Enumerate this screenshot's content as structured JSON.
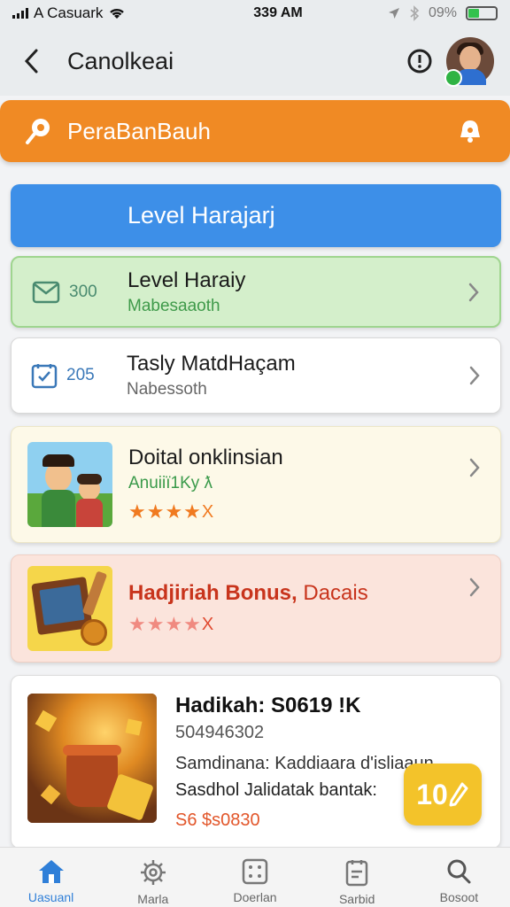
{
  "status_bar": {
    "carrier": "A Casuark",
    "time": "339 AM",
    "battery": "09%"
  },
  "app_bar": {
    "title": "Canolkeai"
  },
  "banner": {
    "text": "PeraBanBauh",
    "color": "#f08a24"
  },
  "level_button": {
    "label": "Level Harajarj",
    "color": "#3d8fe8"
  },
  "rows": [
    {
      "number": "300",
      "title": "Level Haraiy",
      "subtitle": "Mabesaaoth"
    },
    {
      "number": "205",
      "title": "Tasly MatdHaçam",
      "subtitle": "Nabessoth"
    }
  ],
  "promo_cards": [
    {
      "title": "Doital onklinsian",
      "subtitle": "Anuiiï1Ky  ƛ",
      "stars_suffix": "X",
      "rating_stars": 4
    },
    {
      "title": "Hadjiriah Bonus,",
      "title_extra": "Dacais",
      "stars_suffix": "X",
      "rating_stars": 4
    }
  ],
  "offer": {
    "title": "Hadikah: S0619 !K",
    "id": "504946302",
    "line1": "Samdinana: Kaddiaara d'isliaaun",
    "line2": "Sasdhol Jalidatak bantak:",
    "price": "S6 $s0830",
    "fab_label": "10"
  },
  "tabs": [
    {
      "label": "Uasuanl",
      "icon": "home-icon",
      "active": true
    },
    {
      "label": "Marla",
      "icon": "gear-icon",
      "active": false
    },
    {
      "label": "Doerlan",
      "icon": "dice-icon",
      "active": false
    },
    {
      "label": "Sarbid",
      "icon": "document-icon",
      "active": false
    },
    {
      "label": "Bosoot",
      "icon": "search-icon",
      "active": false
    }
  ]
}
